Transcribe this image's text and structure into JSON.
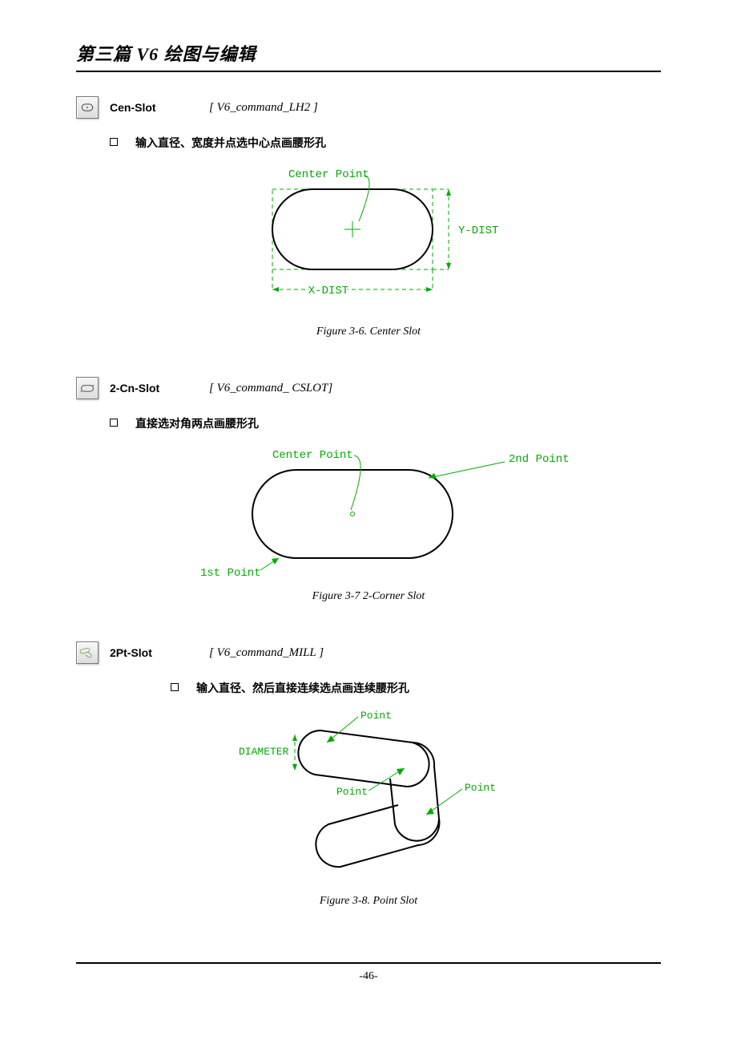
{
  "header": {
    "title": "第三篇    V6 绘图与编辑"
  },
  "sections": [
    {
      "icon": "cen-slot-icon",
      "name": "Cen-Slot",
      "code": "[ V6_command_LH2 ]",
      "bullet": "输入直径、宽度并点选中心点画腰形孔",
      "caption": "Figure 3-6. Center Slot",
      "labels": {
        "center": "Center Point",
        "xdist": "X-DIST",
        "ydist": "Y-DIST"
      }
    },
    {
      "icon": "two-cn-slot-icon",
      "name": "2-Cn-Slot",
      "code": "[ V6_command_ CSLOT]",
      "bullet": "直接选对角两点画腰形孔",
      "caption": "Figure 3-7 2-Corner Slot",
      "labels": {
        "center": "Center Point",
        "p1": "1st Point",
        "p2": "2nd Point"
      }
    },
    {
      "icon": "two-pt-slot-icon",
      "name": "2Pt-Slot",
      "code": "[ V6_command_MILL ]",
      "bullet": "输入直径、然后直接连续选点画连续腰形孔",
      "caption": "Figure 3-8. Point Slot",
      "labels": {
        "dia": "DIAMETER",
        "pt": "Point"
      }
    }
  ],
  "footer": {
    "pagenum": "-46-"
  }
}
